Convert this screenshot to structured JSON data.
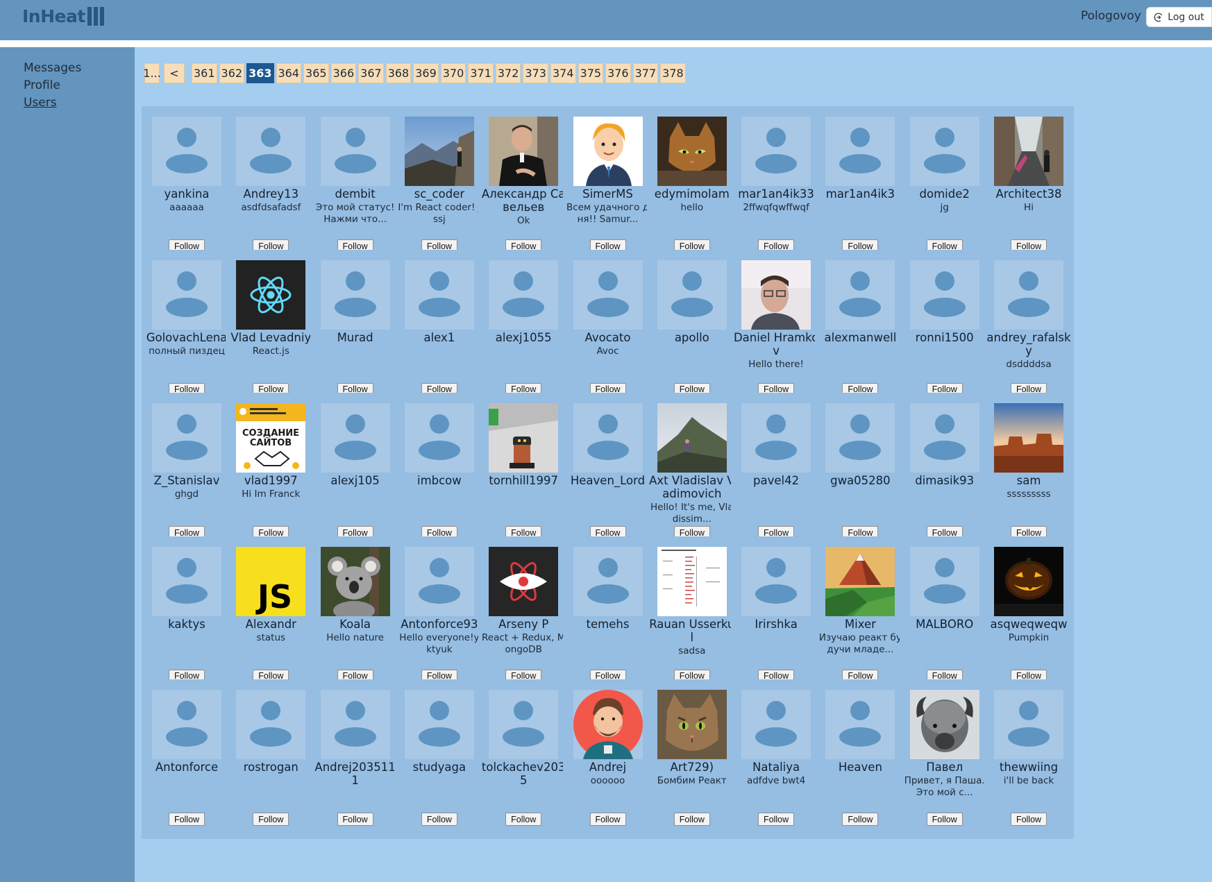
{
  "header": {
    "logo_text": "InHeat",
    "username": "Pologovoy",
    "logout_label": "Log out"
  },
  "sidebar": {
    "items": [
      {
        "label": "Messages",
        "active": false
      },
      {
        "label": "Profile",
        "active": false
      },
      {
        "label": "Users",
        "active": true
      }
    ]
  },
  "pagination": {
    "first_label": "1...",
    "prev_label": "<",
    "pages": [
      "361",
      "362",
      "363",
      "364",
      "365",
      "366",
      "367",
      "368",
      "369",
      "370",
      "371",
      "372",
      "373",
      "374",
      "375",
      "376",
      "377",
      "378"
    ],
    "current": "363"
  },
  "follow_label": "Follow",
  "users": [
    {
      "name": "yankina",
      "status": "aaaaaa",
      "avatar": "default"
    },
    {
      "name": "Andrey13",
      "status": "asdfdsafadsf",
      "avatar": "default"
    },
    {
      "name": "dembit",
      "status": "Это мой статус! Нажми что...",
      "avatar": "default"
    },
    {
      "name": "sc_coder",
      "status": "I'm React coder! jssj",
      "avatar": "mountain-hiker"
    },
    {
      "name": "Александр Савельев",
      "status": "Ok",
      "avatar": "man-portrait"
    },
    {
      "name": "SimerMS",
      "status": "Всем удачного дня!! Samur...",
      "avatar": "cartoon-man"
    },
    {
      "name": "edymimolam",
      "status": "hello",
      "avatar": "cat-mosaic"
    },
    {
      "name": "mar1an4ik33",
      "status": "2ffwqfqwffwqf",
      "avatar": "default"
    },
    {
      "name": "mar1an4ik3",
      "status": "",
      "avatar": "default"
    },
    {
      "name": "domide2",
      "status": "jg",
      "avatar": "default"
    },
    {
      "name": "Architect38",
      "status": "Hi",
      "avatar": "street-scene"
    },
    {
      "name": "GolovachLena",
      "status": "полный пиздец",
      "avatar": "default"
    },
    {
      "name": "Vlad Levadniy",
      "status": "React.js",
      "avatar": "react-logo"
    },
    {
      "name": "Murad",
      "status": "",
      "avatar": "default"
    },
    {
      "name": "alex1",
      "status": "",
      "avatar": "default"
    },
    {
      "name": "alexj1055",
      "status": "",
      "avatar": "default"
    },
    {
      "name": "Avocato",
      "status": "Avoc",
      "avatar": "default"
    },
    {
      "name": "apollo",
      "status": "",
      "avatar": "default"
    },
    {
      "name": "Daniel Hramkov",
      "status": "Hello there!",
      "avatar": "man-glasses"
    },
    {
      "name": "alexmanwell",
      "status": "",
      "avatar": "default"
    },
    {
      "name": "ronni1500",
      "status": "",
      "avatar": "default"
    },
    {
      "name": "andrey_rafalsky",
      "status": "dsddddsa",
      "avatar": "default"
    },
    {
      "name": "Z_Stanislav",
      "status": "ghgd",
      "avatar": "default"
    },
    {
      "name": "vlad1997",
      "status": "Hi Im Franck",
      "avatar": "sites-banner"
    },
    {
      "name": "alexj105",
      "status": "",
      "avatar": "default"
    },
    {
      "name": "imbcow",
      "status": "",
      "avatar": "default"
    },
    {
      "name": "tornhill1997",
      "status": "",
      "avatar": "robot-toy"
    },
    {
      "name": "Heaven_Lord",
      "status": "",
      "avatar": "default"
    },
    {
      "name": "Axt Vladislav Vadimovich",
      "status": "Hello! It's me, Vladissim...",
      "avatar": "mountain-peak"
    },
    {
      "name": "pavel42",
      "status": "",
      "avatar": "default"
    },
    {
      "name": "gwa05280",
      "status": "",
      "avatar": "default"
    },
    {
      "name": "dimasik93",
      "status": "",
      "avatar": "default"
    },
    {
      "name": "sam",
      "status": "sssssssss",
      "avatar": "canyon"
    },
    {
      "name": "kaktys",
      "status": "",
      "avatar": "default"
    },
    {
      "name": "Alexandr",
      "status": "status",
      "avatar": "js-logo"
    },
    {
      "name": "Koala",
      "status": "Hello nature",
      "avatar": "koala"
    },
    {
      "name": "Antonforce93",
      "status": "Hello everyone!yktyuk",
      "avatar": "default"
    },
    {
      "name": "Arseny P",
      "status": "React + Redux, MongoDB",
      "avatar": "eye-logo"
    },
    {
      "name": "temehs",
      "status": "",
      "avatar": "default"
    },
    {
      "name": "Rauan Usserkul",
      "status": "sadsa",
      "avatar": "doc-chart"
    },
    {
      "name": "Irirshka",
      "status": "",
      "avatar": "default"
    },
    {
      "name": "Mixer",
      "status": "Изучаю реакт будучи младе...",
      "avatar": "low-poly"
    },
    {
      "name": "MALBORO",
      "status": "",
      "avatar": "default"
    },
    {
      "name": "asqweqweqw",
      "status": "Pumpkin",
      "avatar": "pumpkin"
    },
    {
      "name": "Antonforce",
      "status": "",
      "avatar": "default"
    },
    {
      "name": "rostrogan",
      "status": "",
      "avatar": "default"
    },
    {
      "name": "Andrej2035111",
      "status": "",
      "avatar": "default"
    },
    {
      "name": "studyaga",
      "status": "",
      "avatar": "default"
    },
    {
      "name": "tolckachev2035",
      "status": "",
      "avatar": "default"
    },
    {
      "name": "Andrej",
      "status": "oooooo",
      "avatar": "cartoon-beard"
    },
    {
      "name": "Art729)",
      "status": "Бомбим Реакт",
      "avatar": "cat-photo"
    },
    {
      "name": "Nataliya",
      "status": "adfdve bwt4",
      "avatar": "default"
    },
    {
      "name": "Heaven",
      "status": "",
      "avatar": "default"
    },
    {
      "name": "Павел",
      "status": "Привет, я Паша. Это мой с...",
      "avatar": "bison"
    },
    {
      "name": "thewwiing",
      "status": "i'll be back",
      "avatar": "default"
    }
  ]
}
